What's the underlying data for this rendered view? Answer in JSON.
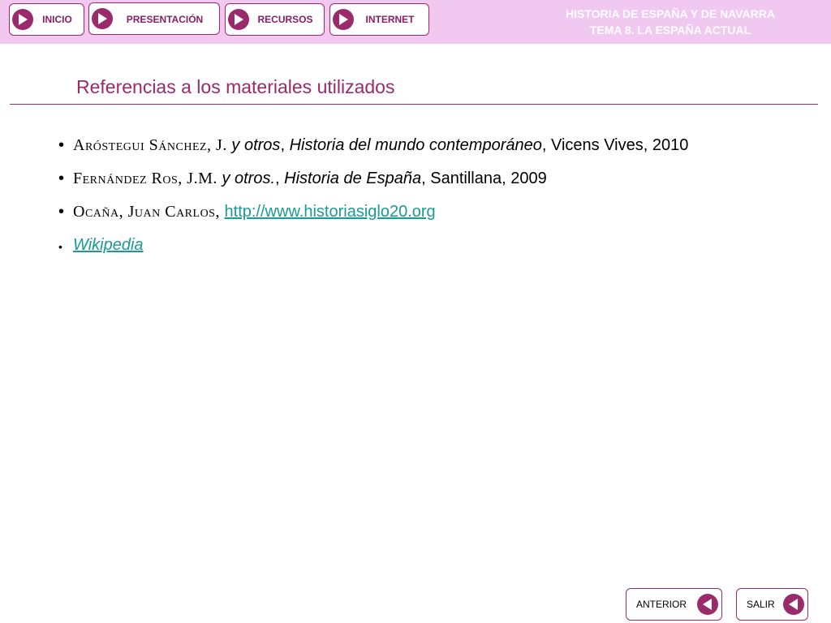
{
  "header": {
    "nav": [
      {
        "label": "INICIO"
      },
      {
        "label": "PRESENTACIÓN"
      },
      {
        "label": "RECURSOS"
      },
      {
        "label": "INTERNET"
      }
    ],
    "title_line1": "HISTORIA DE ESPAÑA Y DE NAVARRA",
    "title_line2": "TEMA 8. LA ESPAÑA ACTUAL"
  },
  "main": {
    "title": "Referencias a los materiales utilizados",
    "references": [
      {
        "author": "Aróstegui Sánchez, J.",
        "sep1": " ",
        "qualifier": "y otros",
        "sep2": ", ",
        "work": "Historia del mundo contemporáneo",
        "rest": ", Vicens Vives, 2010"
      },
      {
        "author": "Fernández Ros, J.M.",
        "sep1": " ",
        "qualifier": "y otros.",
        "sep2": ", ",
        "work": "Historia de España",
        "rest": ", Santillana, 2009"
      },
      {
        "author": "Ocaña, Juan Carlos,",
        "sep1": " ",
        "link": "http://www.historiasiglo20.org"
      },
      {
        "link": "Wikipedia"
      }
    ]
  },
  "footer": {
    "prev_label": "ANTERIOR",
    "exit_label": "SALIR"
  },
  "colors": {
    "brand": "#9a2a6c",
    "header_bg": "#f0c8f0",
    "link": "#1a9a93"
  },
  "icons": {
    "nav": "play-right-icon",
    "back": "play-left-icon"
  }
}
